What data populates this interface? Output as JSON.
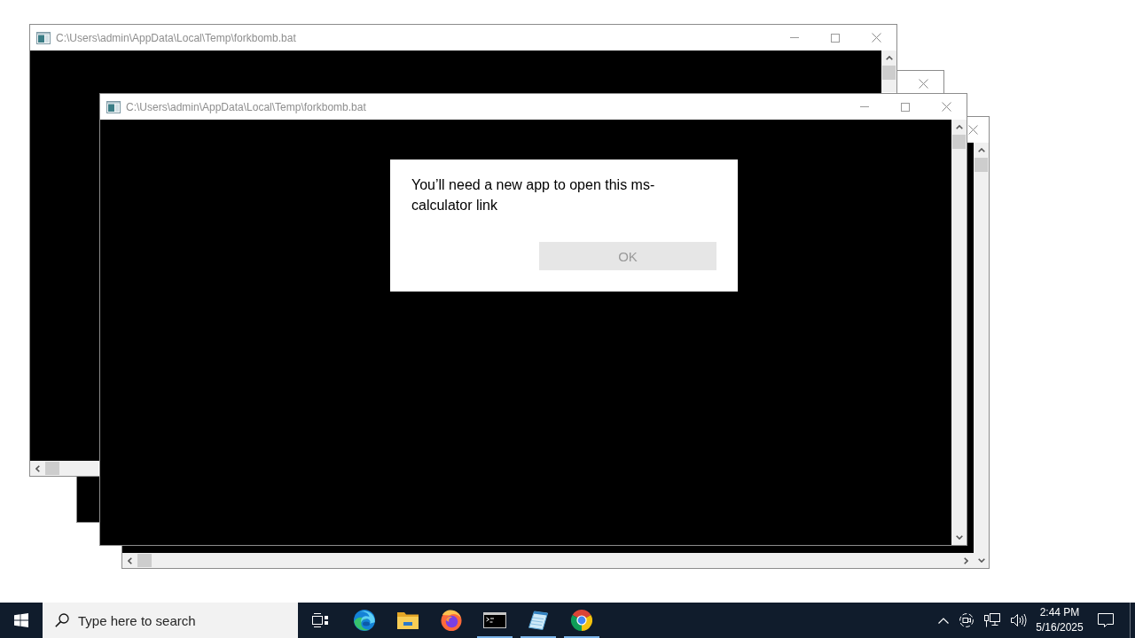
{
  "windows": [
    {
      "title": "C:\\Users\\admin\\AppData\\Local\\Temp\\forkbomb.bat"
    },
    {
      "title": "C:\\Users\\admin\\AppData\\Local\\Temp\\forkbomb.bat"
    }
  ],
  "dialog": {
    "message": "You’ll need a new app to open this ms-calculator link",
    "buttons": [
      {
        "label": "OK",
        "disabled": true
      }
    ]
  },
  "taskbar": {
    "search": {
      "placeholder": "Type here to search"
    },
    "apps": [
      {
        "running": false
      },
      {
        "running": false
      },
      {
        "running": false
      },
      {
        "running": true
      },
      {
        "running": true
      },
      {
        "running": true
      }
    ],
    "clock": {
      "time": "2:44 PM",
      "date": "5/16/2025"
    }
  }
}
